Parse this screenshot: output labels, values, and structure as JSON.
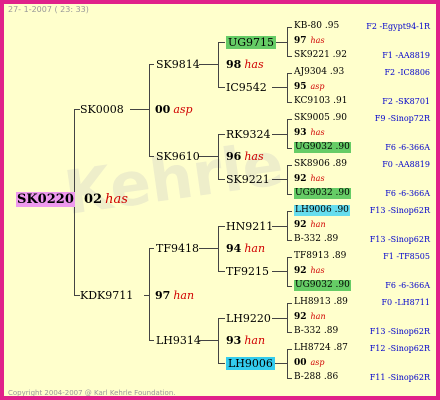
{
  "header": {
    "text": "27-  1-2007 ( 23: 33)"
  },
  "footer": {
    "text": "Copyright 2004-2007 @ Karl Kehrle Foundation."
  },
  "watermark": {
    "text": "Kehrle"
  },
  "colors": {
    "frame": "#e0218a",
    "bg": "#ffffcc",
    "queen": "#d00000",
    "right": "#0000cc",
    "green": "#66cc66",
    "cyan": "#33ccee",
    "root": "#ee99ee"
  },
  "root": {
    "name": "SK0220",
    "year": "02",
    "queen": "has"
  },
  "gen1": [
    {
      "name": "SK0008",
      "year": "00",
      "queen": "asp"
    },
    {
      "name": "KDK9711",
      "year": "97",
      "queen": "han"
    }
  ],
  "gen2": [
    {
      "name": "SK9814",
      "year": "98",
      "queen": "has"
    },
    {
      "name": "SK9610",
      "year": "96",
      "queen": "has"
    },
    {
      "name": "TF9418",
      "year": "94",
      "queen": "han"
    },
    {
      "name": "LH9314",
      "year": "93",
      "queen": "han"
    }
  ],
  "gen3": [
    {
      "name": "UG9715",
      "year": "97",
      "queen": "has"
    },
    {
      "name": "IC9542"
    },
    {
      "name": "RK9324",
      "year": "96",
      "queen": "has"
    },
    {
      "name": "SK9221"
    },
    {
      "name": "HN9211",
      "year": "94",
      "queen": "han"
    },
    {
      "name": "TF9215"
    },
    {
      "name": "LH9220",
      "year": "93",
      "queen": "han"
    },
    {
      "name": "LH9006"
    }
  ],
  "gen4": [
    {
      "a": "KB-80 .95",
      "b": "97",
      "q": "has",
      "c": "SK9221 .92"
    },
    {
      "a": "AJ9304 .93",
      "b": "95",
      "q": "asp",
      "c": "KC9103 .91"
    },
    {
      "a": "SK9005 .90",
      "b": "93",
      "q": "has",
      "c": "UG9032 .90"
    },
    {
      "a": "SK8906 .89",
      "b": "92",
      "q": "has",
      "c": "UG9032 .90"
    },
    {
      "a": "LH9006 .90",
      "b": "92",
      "q": "han",
      "c": "B-332 .89"
    },
    {
      "a": "TF8913 .89",
      "b": "92",
      "q": "has",
      "c": "UG9032 .90"
    },
    {
      "a": "LH8913 .89",
      "b": "92",
      "q": "han",
      "c": "B-332 .89"
    },
    {
      "a": "LH8724 .87",
      "b": "00",
      "q": "asp",
      "c": "B-288 .86"
    }
  ],
  "right": [
    "F2 -Egypt94-1R",
    "F1 -AA8819",
    "F2 -IC8806",
    "F2 -SK8701",
    "F9 -Sinop72R",
    "F6 -6-366A",
    "F0 -AA8819",
    "F6 -6-366A",
    "F13 -Sinop62R",
    "F13 -Sinop62R",
    "F1 -TF8505",
    "F6 -6-366A",
    "F0 -LH8711",
    "F13 -Sinop62R",
    "F12 -Sinop62R",
    "F11 -Sinop62R"
  ]
}
